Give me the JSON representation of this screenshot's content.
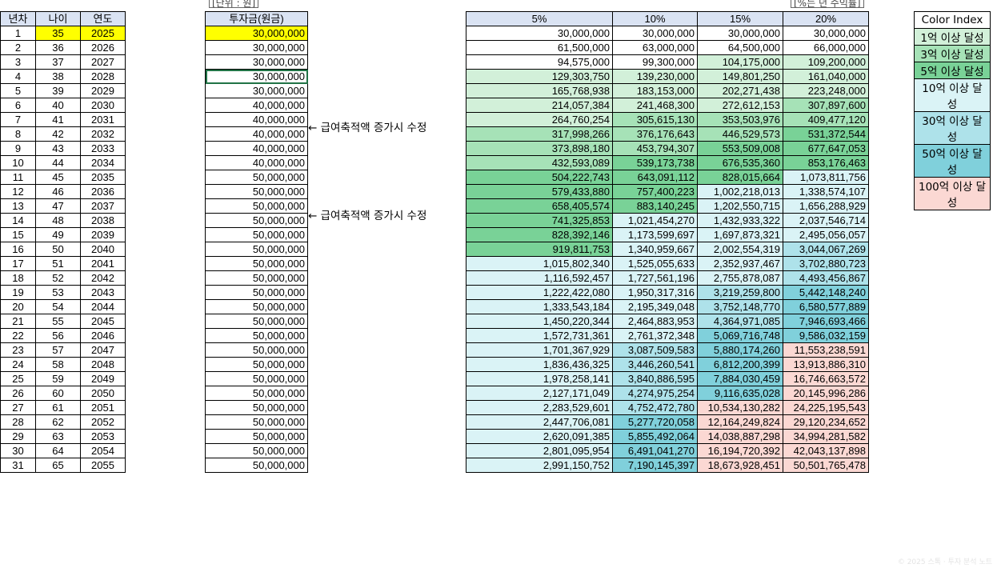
{
  "labels": {
    "col_year_no": "년차",
    "col_age": "나이",
    "col_year": "연도",
    "col_invest": "투자금(원금)",
    "unit_note": "[단위 : 원]",
    "rate_note": "[%는 년 수익률]",
    "edit_note": "← 급여축적액 증가시 수정",
    "rates": [
      "5%",
      "10%",
      "15%",
      "20%"
    ]
  },
  "legend": {
    "title": "Color Index",
    "items": [
      {
        "label": "1억 이상 달성",
        "color": "#d2f0d9"
      },
      {
        "label": "3억 이상 달성",
        "color": "#a6e2b7"
      },
      {
        "label": "5억 이상 달성",
        "color": "#79d297"
      },
      {
        "label": "10억 이상 달성",
        "color": "#daf3f6"
      },
      {
        "label": "30억 이상 달성",
        "color": "#aee2ea"
      },
      {
        "label": "50억 이상 달성",
        "color": "#80d0db"
      },
      {
        "label": "100억 이상 달성",
        "color": "#fbd8d3"
      }
    ]
  },
  "rows": [
    {
      "n": "1",
      "age": "35",
      "year": "2025",
      "invest": "30,000,000",
      "v": [
        "30,000,000",
        "30,000,000",
        "30,000,000",
        "30,000,000"
      ]
    },
    {
      "n": "2",
      "age": "36",
      "year": "2026",
      "invest": "30,000,000",
      "v": [
        "61,500,000",
        "63,000,000",
        "64,500,000",
        "66,000,000"
      ]
    },
    {
      "n": "3",
      "age": "37",
      "year": "2027",
      "invest": "30,000,000",
      "v": [
        "94,575,000",
        "99,300,000",
        "104,175,000",
        "109,200,000"
      ]
    },
    {
      "n": "4",
      "age": "38",
      "year": "2028",
      "invest": "30,000,000",
      "v": [
        "129,303,750",
        "139,230,000",
        "149,801,250",
        "161,040,000"
      ]
    },
    {
      "n": "5",
      "age": "39",
      "year": "2029",
      "invest": "30,000,000",
      "v": [
        "165,768,938",
        "183,153,000",
        "202,271,438",
        "223,248,000"
      ]
    },
    {
      "n": "6",
      "age": "40",
      "year": "2030",
      "invest": "40,000,000",
      "v": [
        "214,057,384",
        "241,468,300",
        "272,612,153",
        "307,897,600"
      ]
    },
    {
      "n": "7",
      "age": "41",
      "year": "2031",
      "invest": "40,000,000",
      "v": [
        "264,760,254",
        "305,615,130",
        "353,503,976",
        "409,477,120"
      ]
    },
    {
      "n": "8",
      "age": "42",
      "year": "2032",
      "invest": "40,000,000",
      "v": [
        "317,998,266",
        "376,176,643",
        "446,529,573",
        "531,372,544"
      ]
    },
    {
      "n": "9",
      "age": "43",
      "year": "2033",
      "invest": "40,000,000",
      "v": [
        "373,898,180",
        "453,794,307",
        "553,509,008",
        "677,647,053"
      ]
    },
    {
      "n": "10",
      "age": "44",
      "year": "2034",
      "invest": "40,000,000",
      "v": [
        "432,593,089",
        "539,173,738",
        "676,535,360",
        "853,176,463"
      ]
    },
    {
      "n": "11",
      "age": "45",
      "year": "2035",
      "invest": "50,000,000",
      "v": [
        "504,222,743",
        "643,091,112",
        "828,015,664",
        "1,073,811,756"
      ]
    },
    {
      "n": "12",
      "age": "46",
      "year": "2036",
      "invest": "50,000,000",
      "v": [
        "579,433,880",
        "757,400,223",
        "1,002,218,013",
        "1,338,574,107"
      ]
    },
    {
      "n": "13",
      "age": "47",
      "year": "2037",
      "invest": "50,000,000",
      "v": [
        "658,405,574",
        "883,140,245",
        "1,202,550,715",
        "1,656,288,929"
      ]
    },
    {
      "n": "14",
      "age": "48",
      "year": "2038",
      "invest": "50,000,000",
      "v": [
        "741,325,853",
        "1,021,454,270",
        "1,432,933,322",
        "2,037,546,714"
      ]
    },
    {
      "n": "15",
      "age": "49",
      "year": "2039",
      "invest": "50,000,000",
      "v": [
        "828,392,146",
        "1,173,599,697",
        "1,697,873,321",
        "2,495,056,057"
      ]
    },
    {
      "n": "16",
      "age": "50",
      "year": "2040",
      "invest": "50,000,000",
      "v": [
        "919,811,753",
        "1,340,959,667",
        "2,002,554,319",
        "3,044,067,269"
      ]
    },
    {
      "n": "17",
      "age": "51",
      "year": "2041",
      "invest": "50,000,000",
      "v": [
        "1,015,802,340",
        "1,525,055,633",
        "2,352,937,467",
        "3,702,880,723"
      ]
    },
    {
      "n": "18",
      "age": "52",
      "year": "2042",
      "invest": "50,000,000",
      "v": [
        "1,116,592,457",
        "1,727,561,196",
        "2,755,878,087",
        "4,493,456,867"
      ]
    },
    {
      "n": "19",
      "age": "53",
      "year": "2043",
      "invest": "50,000,000",
      "v": [
        "1,222,422,080",
        "1,950,317,316",
        "3,219,259,800",
        "5,442,148,240"
      ]
    },
    {
      "n": "20",
      "age": "54",
      "year": "2044",
      "invest": "50,000,000",
      "v": [
        "1,333,543,184",
        "2,195,349,048",
        "3,752,148,770",
        "6,580,577,889"
      ]
    },
    {
      "n": "21",
      "age": "55",
      "year": "2045",
      "invest": "50,000,000",
      "v": [
        "1,450,220,344",
        "2,464,883,953",
        "4,364,971,085",
        "7,946,693,466"
      ]
    },
    {
      "n": "22",
      "age": "56",
      "year": "2046",
      "invest": "50,000,000",
      "v": [
        "1,572,731,361",
        "2,761,372,348",
        "5,069,716,748",
        "9,586,032,159"
      ]
    },
    {
      "n": "23",
      "age": "57",
      "year": "2047",
      "invest": "50,000,000",
      "v": [
        "1,701,367,929",
        "3,087,509,583",
        "5,880,174,260",
        "11,553,238,591"
      ]
    },
    {
      "n": "24",
      "age": "58",
      "year": "2048",
      "invest": "50,000,000",
      "v": [
        "1,836,436,325",
        "3,446,260,541",
        "6,812,200,399",
        "13,913,886,310"
      ]
    },
    {
      "n": "25",
      "age": "59",
      "year": "2049",
      "invest": "50,000,000",
      "v": [
        "1,978,258,141",
        "3,840,886,595",
        "7,884,030,459",
        "16,746,663,572"
      ]
    },
    {
      "n": "26",
      "age": "60",
      "year": "2050",
      "invest": "50,000,000",
      "v": [
        "2,127,171,049",
        "4,274,975,254",
        "9,116,635,028",
        "20,145,996,286"
      ]
    },
    {
      "n": "27",
      "age": "61",
      "year": "2051",
      "invest": "50,000,000",
      "v": [
        "2,283,529,601",
        "4,752,472,780",
        "10,534,130,282",
        "24,225,195,543"
      ]
    },
    {
      "n": "28",
      "age": "62",
      "year": "2052",
      "invest": "50,000,000",
      "v": [
        "2,447,706,081",
        "5,277,720,058",
        "12,164,249,824",
        "29,120,234,652"
      ]
    },
    {
      "n": "29",
      "age": "63",
      "year": "2053",
      "invest": "50,000,000",
      "v": [
        "2,620,091,385",
        "5,855,492,064",
        "14,038,887,298",
        "34,994,281,582"
      ]
    },
    {
      "n": "30",
      "age": "64",
      "year": "2054",
      "invest": "50,000,000",
      "v": [
        "2,801,095,954",
        "6,491,041,270",
        "16,194,720,392",
        "42,043,137,898"
      ]
    },
    {
      "n": "31",
      "age": "65",
      "year": "2055",
      "invest": "50,000,000",
      "v": [
        "2,991,150,752",
        "7,190,145,397",
        "18,673,928,451",
        "50,501,765,478"
      ]
    }
  ]
}
